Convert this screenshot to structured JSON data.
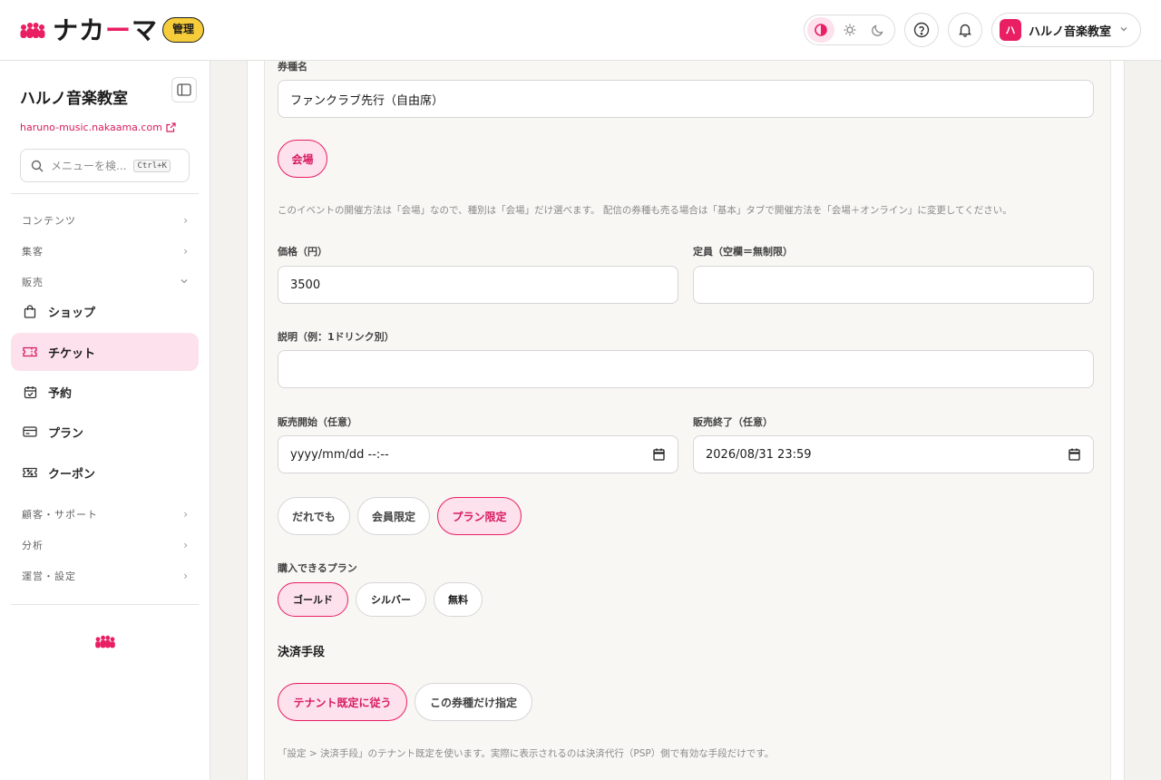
{
  "header": {
    "logo_text_a": "ナカ",
    "logo_text_b": "ー",
    "logo_text_c": "マ",
    "admin_badge": "管理",
    "account": {
      "avatar": "ハ",
      "name": "ハルノ音楽教室"
    },
    "icons": [
      "contrast-icon",
      "sun-icon",
      "moon-icon",
      "help-icon",
      "bell-icon",
      "chevron-down-icon"
    ]
  },
  "sidebar": {
    "title": "ハルノ音楽教室",
    "site_link": "haruno-music.nakaama.com",
    "search": {
      "placeholder": "メニューを検...",
      "shortcut": "Ctrl+K"
    },
    "groups": {
      "contents": "コンテンツ",
      "acquisition": "集客",
      "sales": "販売",
      "customers": "顧客・サポート",
      "analytics": "分析",
      "operations": "運営・設定"
    },
    "items": [
      {
        "label": "ショップ",
        "icon": "shopping-bag-icon"
      },
      {
        "label": "チケット",
        "icon": "ticket-icon",
        "active": true
      },
      {
        "label": "予約",
        "icon": "calendar-check-icon"
      },
      {
        "label": "プラン",
        "icon": "card-icon"
      },
      {
        "label": "クーポン",
        "icon": "coupon-icon"
      }
    ]
  },
  "form": {
    "ticket_name": {
      "label": "券種名",
      "value": "ファンクラブ先行（自由席）"
    },
    "type_pill": "会場",
    "type_hint": "このイベントの開催方法は「会場」なので、種別は「会場」だけ選べます。 配信の券種も売る場合は「基本」タブで開催方法を「会場＋オンライン」に変更してください。",
    "price": {
      "label": "価格（円）",
      "value": "3500"
    },
    "capacity": {
      "label": "定員（空欄＝無制限）",
      "value": ""
    },
    "description": {
      "label": "説明（例：1ドリンク別）",
      "value": ""
    },
    "sale_start": {
      "label": "販売開始（任意）",
      "value": "yyyy/mm/dd --:--"
    },
    "sale_end": {
      "label": "販売終了（任意）",
      "value": "2026/08/31 23:59"
    },
    "audience": {
      "options": [
        "だれでも",
        "会員限定",
        "プラン限定"
      ],
      "selected": "プラン限定"
    },
    "plans": {
      "label": "購入できるプラン",
      "options": [
        "ゴールド",
        "シルバー",
        "無料"
      ],
      "selected": "ゴールド"
    },
    "payment": {
      "title": "決済手段",
      "options": [
        "テナント既定に従う",
        "この券種だけ指定"
      ],
      "selected": "テナント既定に従う",
      "hint": "「設定 > 決済手段」のテナント既定を使います。実際に表示されるのは決済代行（PSP）側で有効な手段だけです。"
    }
  },
  "colors": {
    "accent": "#e91e63",
    "accent_bg": "#fde1ec",
    "badge": "#f6cc3a"
  }
}
